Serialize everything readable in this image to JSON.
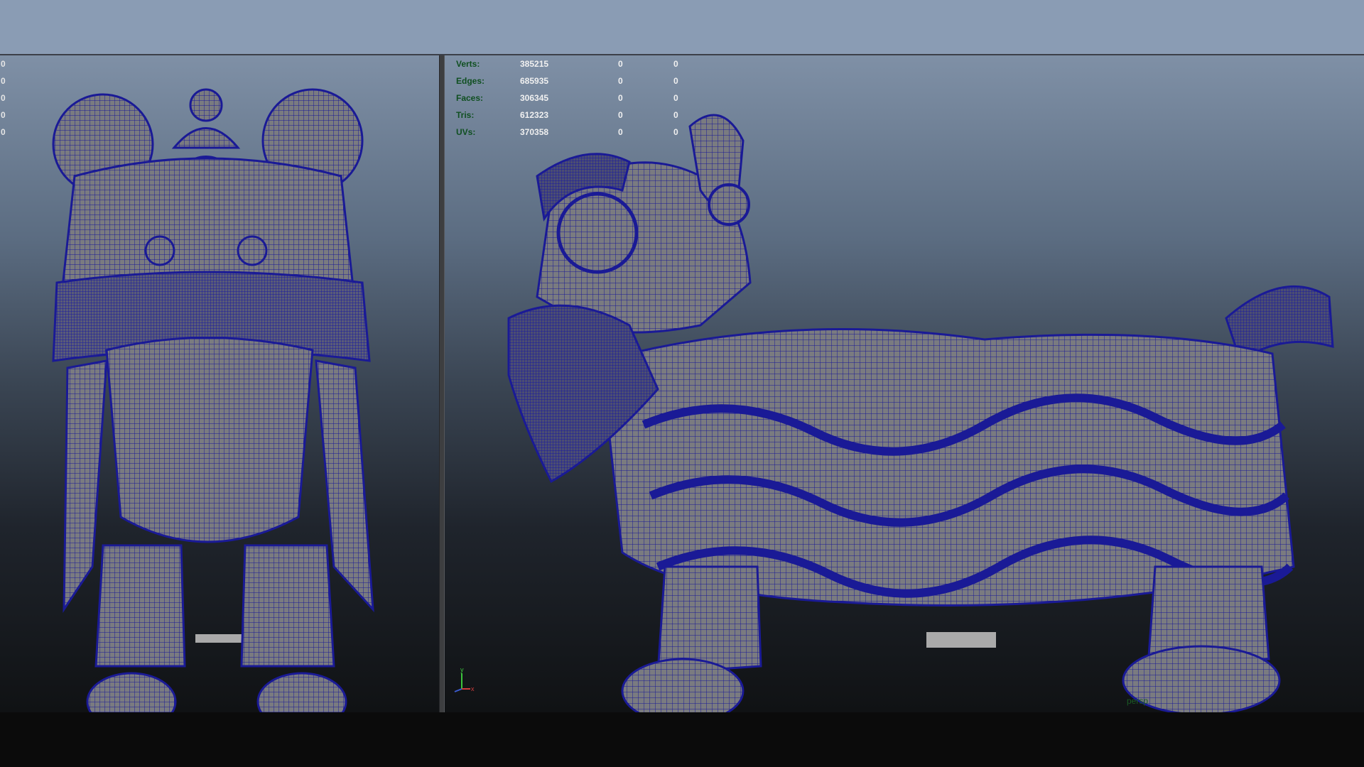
{
  "hud": {
    "rows": [
      {
        "label": "Verts:",
        "value": "385215",
        "c1": "0",
        "c2": "0"
      },
      {
        "label": "Edges:",
        "value": "685935",
        "c1": "0",
        "c2": "0"
      },
      {
        "label": "Faces:",
        "value": "306345",
        "c1": "0",
        "c2": "0"
      },
      {
        "label": "Tris:",
        "value": "612323",
        "c1": "0",
        "c2": "0"
      },
      {
        "label": "UVs:",
        "value": "370358",
        "c1": "0",
        "c2": "0"
      }
    ],
    "left_column_values": [
      "0",
      "0",
      "0",
      "0",
      "0"
    ]
  },
  "viewport_right": {
    "camera_label": "persp",
    "axis_y_label": "y",
    "axis_x_label": "x"
  },
  "colors": {
    "wire": "#1a1a96",
    "mesh_fill": "#7a7b80",
    "hud_label": "#0f4f20",
    "hud_value": "#f0f0f0",
    "top_strip": "#8a9cb4"
  }
}
